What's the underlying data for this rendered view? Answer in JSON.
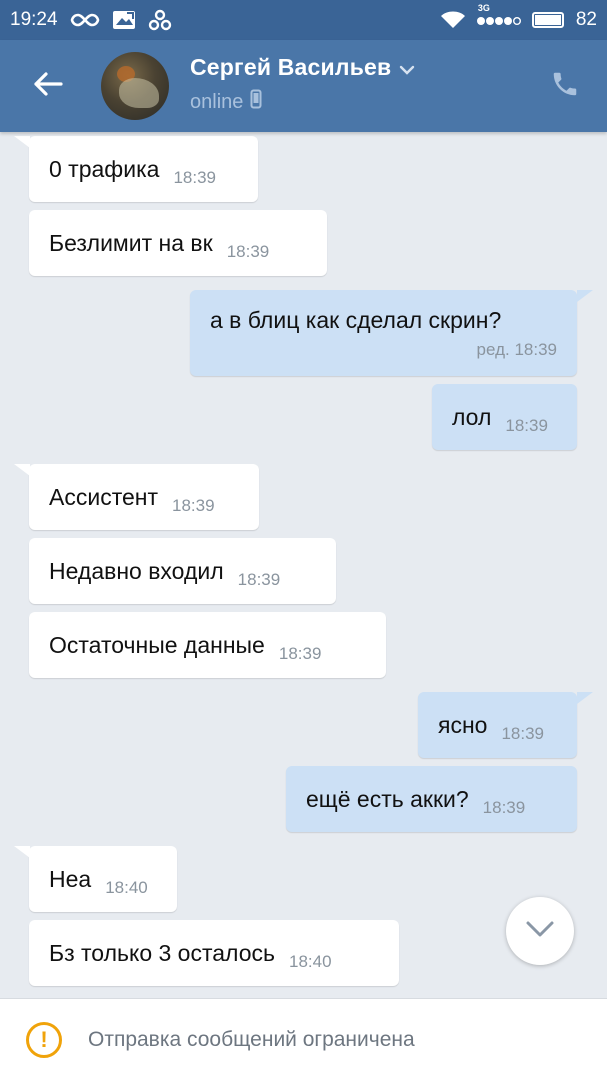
{
  "status_bar": {
    "time": "19:24",
    "network": "3G",
    "battery": "82"
  },
  "header": {
    "contact_name": "Сергей Васильев",
    "contact_status": "online"
  },
  "messages": [
    {
      "dir": "in",
      "text": "0 трафика",
      "time": "18:39"
    },
    {
      "dir": "in",
      "text": "Безлимит на вк",
      "time": "18:39"
    },
    {
      "dir": "out",
      "text": "а в блиц как сделал скрин?",
      "time": "ред. 18:39"
    },
    {
      "dir": "out",
      "text": "лол",
      "time": "18:39"
    },
    {
      "dir": "in",
      "text": "Ассистент",
      "time": "18:39"
    },
    {
      "dir": "in",
      "text": "Недавно входил",
      "time": "18:39"
    },
    {
      "dir": "in",
      "text": "Остаточные данные",
      "time": "18:39"
    },
    {
      "dir": "out",
      "text": "ясно",
      "time": "18:39"
    },
    {
      "dir": "out",
      "text": "ещё есть акки?",
      "time": "18:39"
    },
    {
      "dir": "in",
      "text": "Неа",
      "time": "18:40"
    },
    {
      "dir": "in",
      "text": "Бз только 3 осталось",
      "time": "18:40"
    }
  ],
  "footer": {
    "notice": "Отправка сообщений ограничена"
  },
  "colors": {
    "statusbar": "#3a6496",
    "header": "#4a76a8",
    "background": "#e7ebf0",
    "bubble_in": "#ffffff",
    "bubble_out": "#cce0f5",
    "warning": "#f0a30a"
  }
}
